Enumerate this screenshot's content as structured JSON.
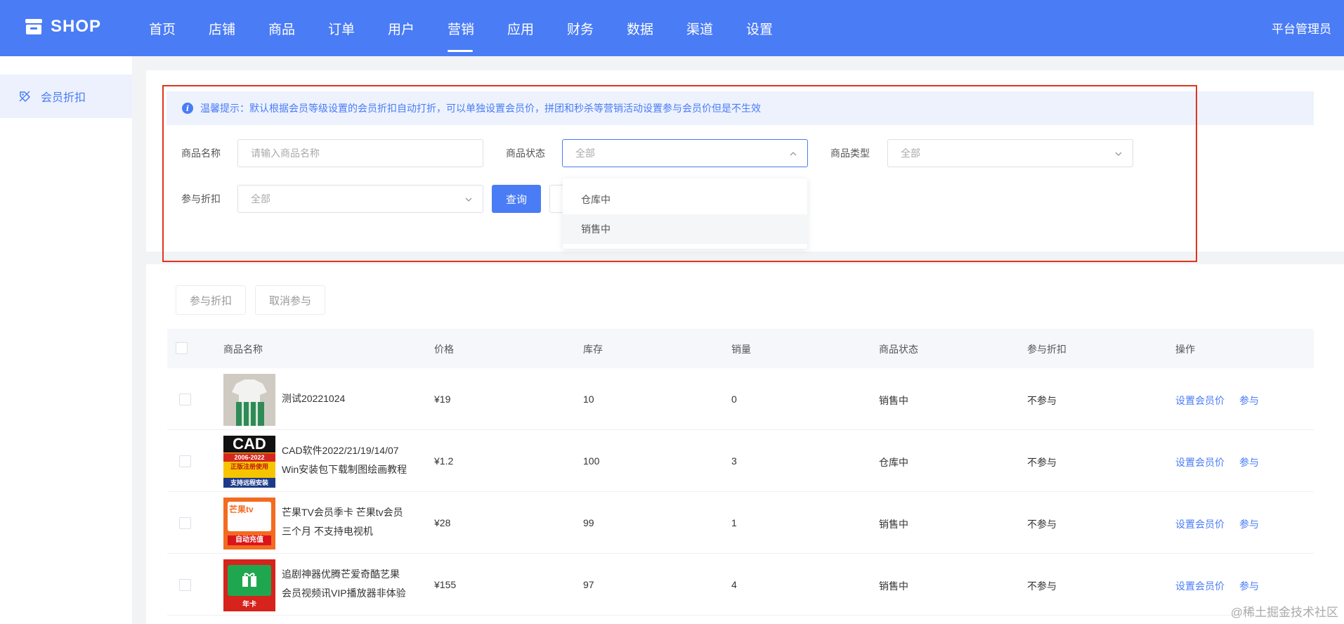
{
  "header": {
    "brand": "SHOP",
    "nav": [
      "首页",
      "店铺",
      "商品",
      "订单",
      "用户",
      "营销",
      "应用",
      "财务",
      "数据",
      "渠道",
      "设置"
    ],
    "active_nav": "营销",
    "admin_label": "平台管理员"
  },
  "sidebar": {
    "items": [
      {
        "label": "会员折扣",
        "icon": "discount-tag-icon"
      }
    ]
  },
  "filter": {
    "tip": "温馨提示：默认根据会员等级设置的会员折扣自动打折，可以单独设置会员价，拼团和秒杀等营销活动设置参与会员价但是不生效",
    "name_label": "商品名称",
    "name_placeholder": "请输入商品名称",
    "status_label": "商品状态",
    "status_value": "全部",
    "type_label": "商品类型",
    "type_value": "全部",
    "discount_label": "参与折扣",
    "discount_value": "全部",
    "search_button": "查询",
    "status_options": [
      "仓库中",
      "销售中"
    ]
  },
  "actions": {
    "join": "参与折扣",
    "cancel": "取消参与"
  },
  "table": {
    "columns": [
      "商品名称",
      "价格",
      "库存",
      "销量",
      "商品状态",
      "参与折扣",
      "操作"
    ],
    "rows": [
      {
        "name_line1": "测试20221024",
        "name_line2": "",
        "price": "¥19",
        "stock": "10",
        "sales": "0",
        "status": "销售中",
        "discount": "不参与",
        "op1": "设置会员价",
        "op2": "参与"
      },
      {
        "name_line1": "CAD软件2022/21/19/14/07",
        "name_line2": "Win安装包下载制图绘画教程",
        "price": "¥1.2",
        "stock": "100",
        "sales": "3",
        "status": "仓库中",
        "discount": "不参与",
        "op1": "设置会员价",
        "op2": "参与"
      },
      {
        "name_line1": "芒果TV会员季卡 芒果tv会员",
        "name_line2": "三个月 不支持电视机",
        "price": "¥28",
        "stock": "99",
        "sales": "1",
        "status": "销售中",
        "discount": "不参与",
        "op1": "设置会员价",
        "op2": "参与"
      },
      {
        "name_line1": "追剧神器优腾芒爱奇酷艺果",
        "name_line2": "会员视频讯VIP播放器非体验",
        "price": "¥155",
        "stock": "97",
        "sales": "4",
        "status": "销售中",
        "discount": "不参与",
        "op1": "设置会员价",
        "op2": "参与"
      }
    ]
  },
  "thumbs": {
    "cad_title": "CAD",
    "cad_years": "2006-2022",
    "cad_sub": "正版注册使用",
    "cad_bottom": "支持远程安装",
    "mango_brand": "芒果tv",
    "mango_text": "自动充值",
    "video_text": "年卡"
  },
  "watermark": "@稀土掘金技术社区",
  "colors": {
    "primary": "#4a7cf6",
    "highlight_box": "#e0341c"
  }
}
